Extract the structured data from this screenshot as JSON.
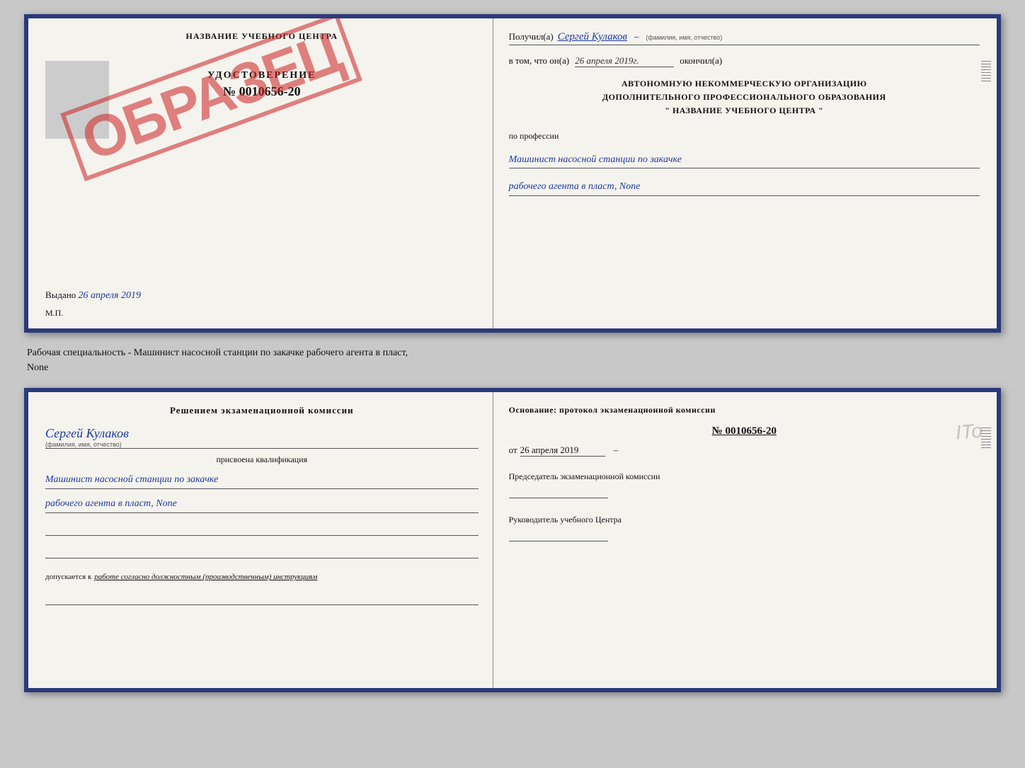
{
  "doc_top": {
    "left": {
      "header": "НАЗВАНИЕ УЧЕБНОГО ЦЕНТРА",
      "stamp": "ОБРАЗЕЦ",
      "udostoverenie": "УДОСТОВЕРЕНИЕ",
      "number": "№ 0010656-20",
      "vydano_label": "Выдано",
      "vydano_date": "26 апреля 2019",
      "mp_label": "М.П."
    },
    "right": {
      "poluchil_label": "Получил(а)",
      "poluchil_name": "Сергей Кулаков",
      "familiya_hint": "(фамилия, имя, отчество)",
      "vtom_label": "в том, что он(а)",
      "vtom_date": "26 апреля 2019г.",
      "okonchl_label": "окончил(а)",
      "org_line1": "АВТОНОМНУЮ НЕКОММЕРЧЕСКУЮ ОРГАНИЗАЦИЮ",
      "org_line2": "ДОПОЛНИТЕЛЬНОГО ПРОФЕССИОНАЛЬНОГО ОБРАЗОВАНИЯ",
      "org_line3": "\"  НАЗВАНИЕ УЧЕБНОГО ЦЕНТРА  \"",
      "po_professii": "по профессии",
      "prof1": "Машинист насосной станции по закачке",
      "prof2": "рабочего агента в пласт, None"
    }
  },
  "middle": {
    "text": "Рабочая специальность - Машинист насосной станции по закачке рабочего агента в пласт,",
    "text2": "None"
  },
  "doc_bottom": {
    "left": {
      "resheniem": "Решением экзаменационной комиссии",
      "fio_name": "Сергей Кулаков",
      "familiya_hint": "(фамилия, имя, отчество)",
      "prisvoyena": "присвоена квалификация",
      "kvali1": "Машинист насосной станции по закачке",
      "kvali2": "рабочего агента в пласт, None",
      "dopuskaetsya_label": "допускается к",
      "dopuskaetsya_text": "работе согласно должностным (производственным) инструкциям"
    },
    "right": {
      "osnovanie": "Основание: протокол экзаменационной комиссии",
      "protokol_num": "№ 0010656-20",
      "ot_label": "от",
      "ot_date": "26 апреля 2019",
      "predsedatel_label": "Председатель экзаменационной комиссии",
      "rukovoditel_label": "Руководитель учебного Центра"
    }
  }
}
